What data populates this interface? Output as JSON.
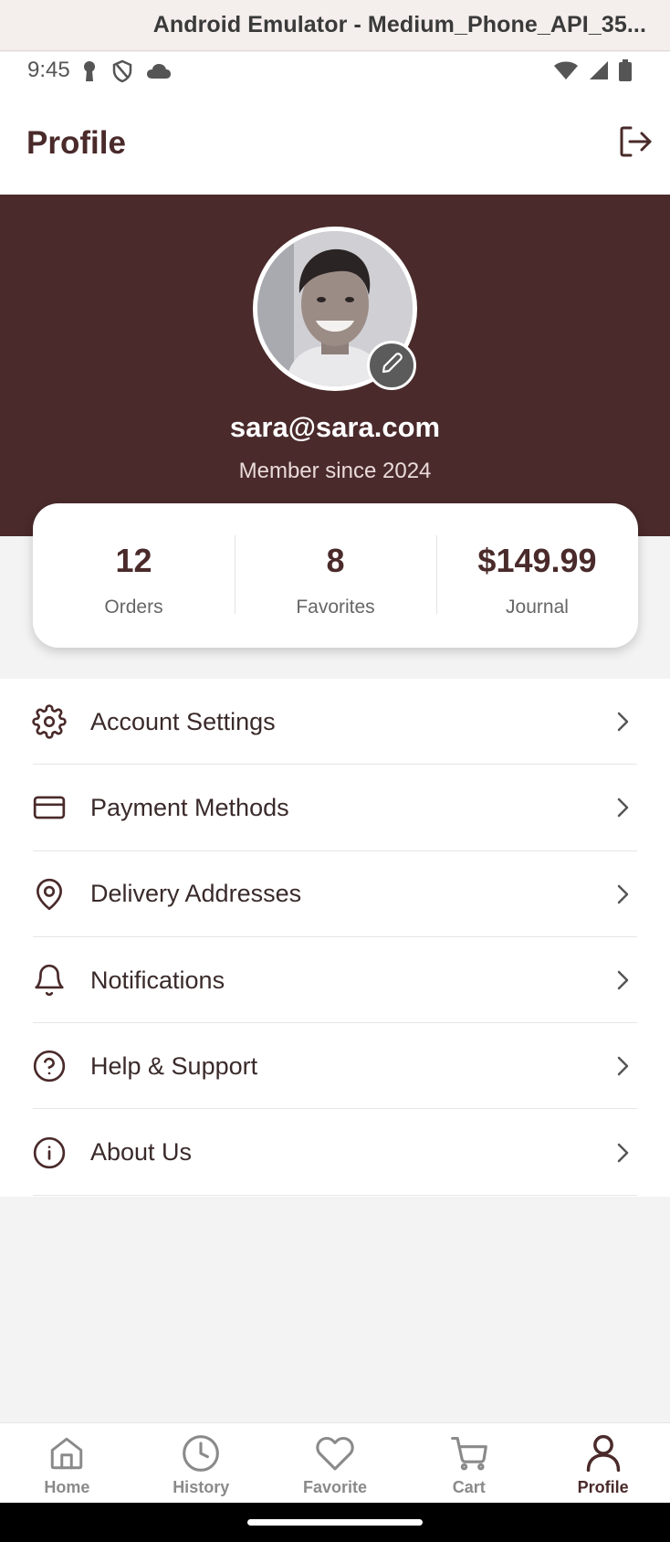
{
  "emulator": {
    "title": "Android Emulator - Medium_Phone_API_35..."
  },
  "status_bar": {
    "time": "9:45",
    "left_icons": [
      "key-icon",
      "shield-icon",
      "cloud-icon"
    ],
    "right_icons": [
      "wifi-icon",
      "signal-icon",
      "battery-icon"
    ]
  },
  "header": {
    "title": "Profile",
    "logout_icon": "logout-icon"
  },
  "profile": {
    "email": "sara@sara.com",
    "member_since": "Member since 2024",
    "hero_color": "#4a2a2b"
  },
  "stats": [
    {
      "value": "12",
      "label": "Orders"
    },
    {
      "value": "8",
      "label": "Favorites"
    },
    {
      "value": "$149.99",
      "label": "Journal"
    }
  ],
  "menu": [
    {
      "label": "Account Settings",
      "icon": "gear-icon"
    },
    {
      "label": "Payment Methods",
      "icon": "credit-card-icon"
    },
    {
      "label": "Delivery Addresses",
      "icon": "location-pin-icon"
    },
    {
      "label": "Notifications",
      "icon": "bell-icon"
    },
    {
      "label": "Help & Support",
      "icon": "help-circle-icon"
    },
    {
      "label": "About Us",
      "icon": "info-circle-icon"
    }
  ],
  "bottom_nav": [
    {
      "label": "Home",
      "icon": "home-icon"
    },
    {
      "label": "History",
      "icon": "clock-icon"
    },
    {
      "label": "Favorite",
      "icon": "heart-icon"
    },
    {
      "label": "Cart",
      "icon": "cart-icon"
    },
    {
      "label": "Profile",
      "icon": "user-icon",
      "active": true
    }
  ],
  "colors": {
    "brand": "#4a2a2a",
    "inactive": "#8a8a8a"
  }
}
